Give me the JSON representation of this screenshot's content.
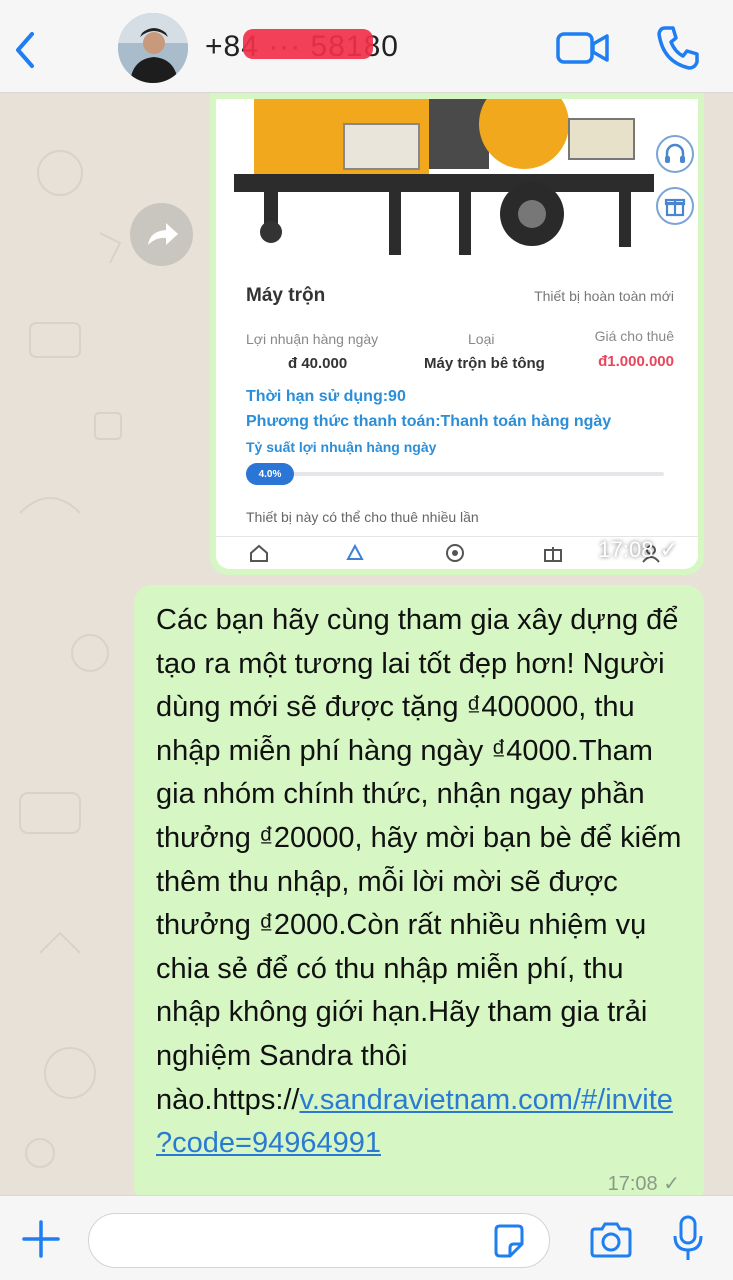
{
  "header": {
    "contact_name": "+84 ··· 58180"
  },
  "image_message": {
    "title": "Máy trộn",
    "tag": "Thiết bị hoàn toàn mới",
    "daily_profit_label": "Lợi nhuận hàng ngày",
    "daily_profit_value": "đ 40.000",
    "type_label": "Loại",
    "type_value": "Máy trộn bê tông",
    "rent_price_label": "Giá cho thuê",
    "rent_price_value": "đ1.000.000",
    "usage_period": "Thời hạn sử dụng:90",
    "payment_method": "Phương thức thanh toán:Thanh toán hàng ngày",
    "profit_rate_label": "Tỷ suất lợi nhuận hàng ngày",
    "profit_rate_value": "4.0%",
    "profit_rate_fraction": 0.04,
    "device_note": "Thiết bị này có thể cho thuê nhiều lần",
    "time": "17:08"
  },
  "text_message": {
    "body": "Các bạn hãy cùng tham gia xây dựng để tạo ra một tương lai tốt đẹp hơn! Người dùng mới sẽ được tặng ₫400000, thu nhập miễn phí hàng ngày ₫4000.Tham gia nhóm chính thức, nhận ngay phần thưởng ₫20000, hãy mời bạn bè để kiếm thêm thu nhập, mỗi lời mời sẽ được thưởng ₫2000.Còn rất nhiều nhiệm vụ chia sẻ để có thu nhập miễn phí, thu nhập không giới hạn.Hãy tham gia trải nghiệm Sandra thôi nào.https://",
    "link": "v.sandravietnam.com/#/invite?code=94964991",
    "time": "17:08"
  },
  "input": {
    "placeholder": ""
  },
  "colors": {
    "bubble": "#d6f7c4",
    "accent": "#2a7ad4",
    "price": "#e8465a"
  }
}
